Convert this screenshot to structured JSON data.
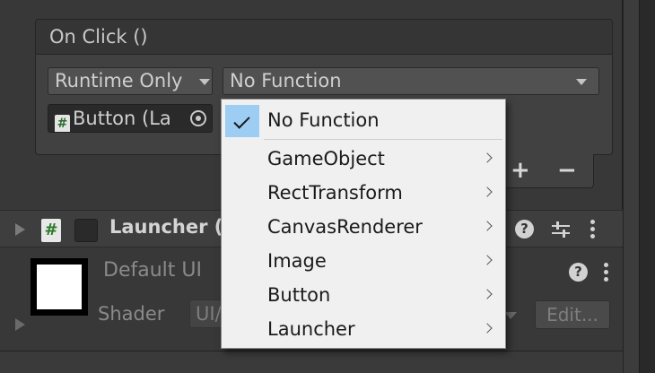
{
  "event": {
    "title": "On Click ()",
    "runtime_dropdown": "Runtime Only",
    "function_dropdown": "No Function",
    "object_field": "Button (La",
    "add_label": "+",
    "remove_label": "−"
  },
  "component": {
    "title": "Launcher (",
    "script_badge": "#",
    "help_glyph": "?"
  },
  "material": {
    "name": "Default UI",
    "shader_label": "Shader",
    "shader_value": "UI/",
    "edit_label": "Edit...",
    "help_glyph": "?"
  },
  "popup": {
    "selected": "No Function",
    "items": [
      {
        "label": "GameObject"
      },
      {
        "label": "RectTransform"
      },
      {
        "label": "CanvasRenderer"
      },
      {
        "label": "Image"
      },
      {
        "label": "Button"
      },
      {
        "label": "Launcher"
      }
    ]
  },
  "colors": {
    "panel": "#383838",
    "popup_bg": "#f0f0f0",
    "selection": "#9ecdf4"
  }
}
